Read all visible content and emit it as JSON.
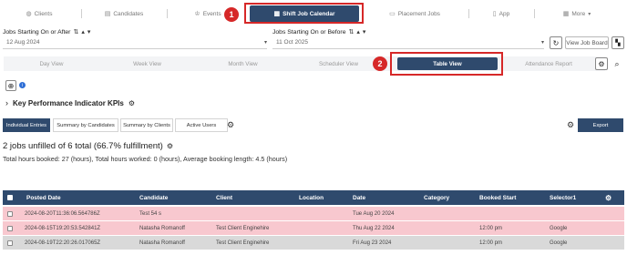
{
  "nav": {
    "items": [
      {
        "label": "Clients",
        "icon": "globe-icon"
      },
      {
        "label": "Candidates",
        "icon": "id-card-icon"
      },
      {
        "label": "Events",
        "icon": "trophy-icon"
      },
      {
        "label": "Shift Job Calendar",
        "icon": "calendar-icon"
      },
      {
        "label": "Placement Jobs",
        "icon": "briefcase-icon"
      },
      {
        "label": "App",
        "icon": "mobile-icon"
      },
      {
        "label": "More",
        "icon": "grid-icon"
      }
    ]
  },
  "callouts": {
    "one": "1",
    "two": "2"
  },
  "filters": {
    "after_label": "Jobs Starting On or After",
    "after_value": "12 Aug 2024",
    "before_label": "Jobs Starting On or Before",
    "before_value": "11 Oct 2025",
    "view_job_board": "View Job Board"
  },
  "views": [
    "Day View",
    "Week View",
    "Month View",
    "Scheduler View",
    "Table View",
    "Attendance Report"
  ],
  "kpi_title": "Key Performance Indicator KPIs",
  "subtabs": [
    "Individual Entries",
    "Summary by Candidates",
    "Summary by Clients",
    "Active Users"
  ],
  "export_label": "Export",
  "summary": {
    "headline": "2 jobs unfilled of 6 total (66.7% fulfillment)",
    "stats": "Total hours booked: 27 (hours), Total hours worked: 0 (hours), Average booking length: 4.5 (hours)"
  },
  "table": {
    "headers": [
      "Posted Date",
      "Candidate",
      "Client",
      "Location",
      "Date",
      "Category",
      "Booked Start",
      "Selector1"
    ],
    "rows": [
      {
        "posted": "2024-08-20T11:36:06.564786Z",
        "candidate": "Test 54 s",
        "client": "",
        "location": "",
        "date": "Tue Aug 20 2024",
        "category": "",
        "booked_start": "",
        "selector1": "",
        "bg": "#f8c8cf"
      },
      {
        "posted": "2024-08-15T19:20:53.542841Z",
        "candidate": "Natasha Romanoff",
        "client": "Test Client Enginehire",
        "location": "",
        "date": "Thu Aug 22 2024",
        "category": "",
        "booked_start": "12:00 pm",
        "selector1": "Google",
        "bg": "#f8c8cf"
      },
      {
        "posted": "2024-08-19T22:20:26.017065Z",
        "candidate": "Natasha Romanoff",
        "client": "Test Client Enginehire",
        "location": "",
        "date": "Fri Aug 23 2024",
        "category": "",
        "booked_start": "12:00 pm",
        "selector1": "Google",
        "bg": "#d9d9d9"
      }
    ]
  },
  "colors": {
    "primary": "#2f4a6d",
    "callout": "#d62828",
    "unfilled_row": "#f8c8cf"
  }
}
